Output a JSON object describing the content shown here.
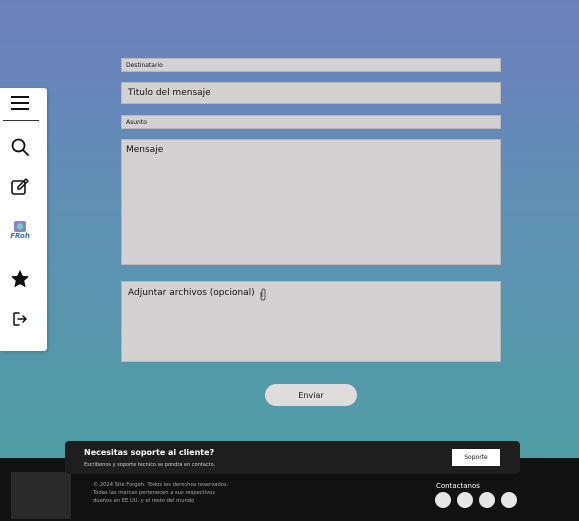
{
  "sidebar": {
    "items": [
      {
        "icon": "menu-icon"
      },
      {
        "icon": "search-icon"
      },
      {
        "icon": "edit-icon"
      },
      {
        "icon": "frog-logo-icon",
        "logo_text": "FRoh"
      },
      {
        "icon": "star-icon"
      },
      {
        "icon": "logout-icon"
      }
    ]
  },
  "form": {
    "recipient_label": "Destinatario",
    "title_placeholder": "Titulo del  mensaje",
    "subject_label": "Asunto",
    "message_placeholder": "Mensaje",
    "attach_label": "Adjuntar archivos (opcional)",
    "send_label": "Enviar"
  },
  "support": {
    "title": "Necesitas soporte al cliente?",
    "subtitle": "Escribenos y soporte tecnico se pondra en contacto.",
    "button_label": "Soporte"
  },
  "footer": {
    "copyright": "© 2024 Site Forgeh. Todos los derechos reservados. Todas las marcas pertenecen a sus respectivos dueños en EE.UU. y el resto del mundo",
    "contact_label": "Contactanos",
    "social_count": 4
  },
  "colors": {
    "background_top": "#6c7fbd",
    "background_bottom": "#4aa0a0",
    "field": "#d3d1d2",
    "footer": "#111111"
  }
}
